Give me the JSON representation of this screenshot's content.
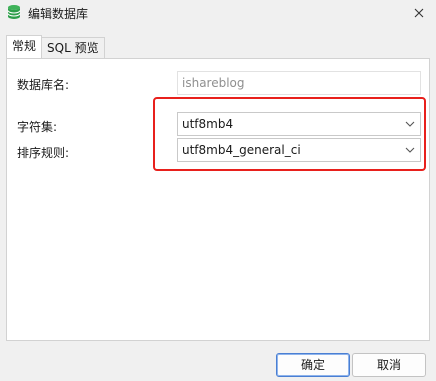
{
  "window": {
    "title": "编辑数据库",
    "icon": "database-icon"
  },
  "tabs": [
    {
      "label": "常规",
      "active": true
    },
    {
      "label": "SQL 预览",
      "active": false
    }
  ],
  "form": {
    "db_name_label": "数据库名:",
    "db_name_value": "ishareblog",
    "charset_label": "字符集:",
    "charset_value": "utf8mb4",
    "collation_label": "排序规则:",
    "collation_value": "utf8mb4_general_ci"
  },
  "buttons": {
    "ok_label": "确定",
    "cancel_label": "取消"
  },
  "colors": {
    "highlight": "#e8201c",
    "database_icon": "#2e9e4a"
  }
}
